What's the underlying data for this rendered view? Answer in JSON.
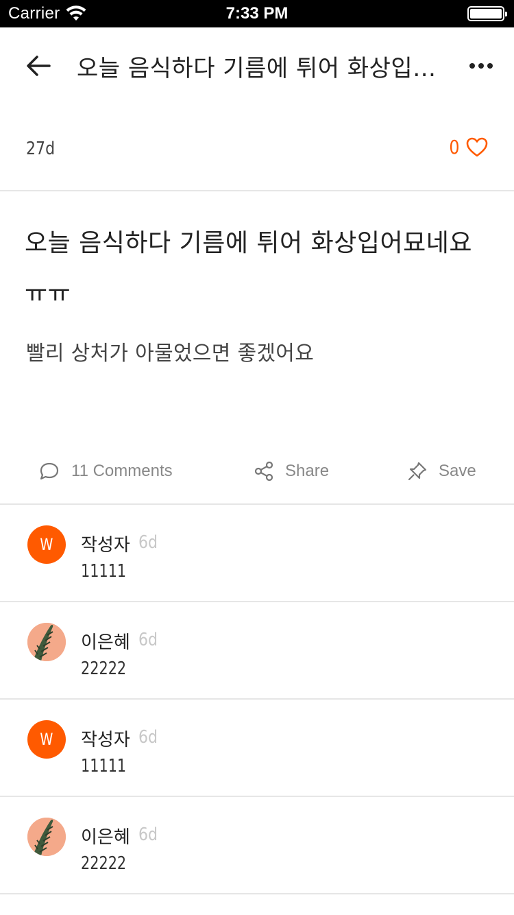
{
  "status_bar": {
    "carrier": "Carrier",
    "time": "7:33 PM"
  },
  "nav": {
    "title": "오늘  음식하다 기름에 튀어  화상입어묘네요 ㅠㅠ"
  },
  "post": {
    "time": "27d",
    "likes": "0",
    "title": "오늘  음식하다 기름에 튀어  화상입어묘네요 ㅠㅠ",
    "body": "빨리  상처가 아물었으면 좋겠어요"
  },
  "actions": {
    "comments_label": "11 Comments",
    "share_label": "Share",
    "save_label": "Save"
  },
  "comments": [
    {
      "avatar_letter": "W",
      "author": "작성자",
      "time": "6d",
      "text": "11111"
    },
    {
      "author": "이은혜",
      "time": "6d",
      "text": "22222"
    },
    {
      "avatar_letter": "W",
      "author": "작성자",
      "time": "6d",
      "text": "11111"
    },
    {
      "author": "이은혜",
      "time": "6d",
      "text": "22222"
    }
  ],
  "colors": {
    "accent": "#ff5a00",
    "muted": "#888888",
    "divider": "#e6e6e6"
  }
}
